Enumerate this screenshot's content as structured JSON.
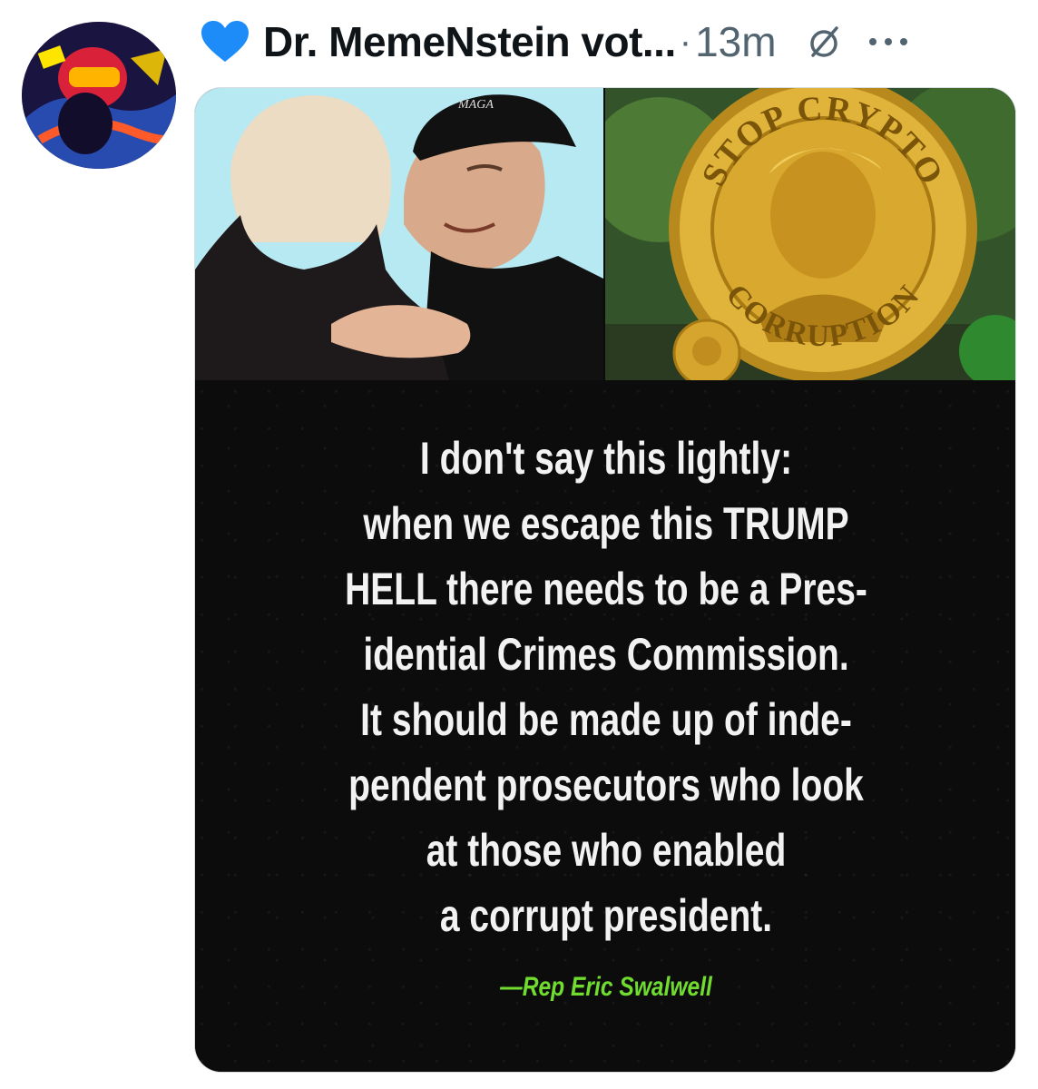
{
  "post": {
    "author_display_name": "Dr. MemeNstein vot...",
    "separator": "·",
    "timestamp": "13m",
    "icons": {
      "heart": "blue-heart-icon",
      "muted": "circle-slash-icon",
      "more": "more-options-icon"
    },
    "colors": {
      "heart": "#1d8cf8",
      "name": "#0f1419",
      "meta": "#536471",
      "quote_text": "#f2f2f2",
      "attribution": "#6fdc2f",
      "coin_gold": "#e0b33a"
    }
  },
  "image": {
    "left_photo": {
      "cap_text": "MAGA"
    },
    "right_photo": {
      "coin_top_text": "STOP CRYPTO",
      "coin_bottom_text": "CORRUPTION"
    },
    "quote_lines": [
      "I don't say this lightly:",
      "when we escape this TRUMP",
      "HELL there needs to be a Pres-",
      "idential Crimes Commission.",
      "It should be made up of inde-",
      "pendent prosecutors who look",
      "at those who enabled",
      "a corrupt president."
    ],
    "attribution": "—Rep Eric Swalwell"
  }
}
